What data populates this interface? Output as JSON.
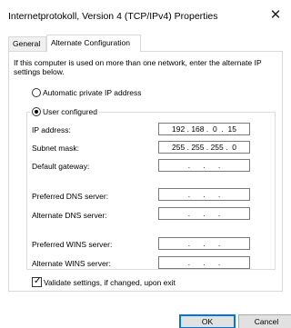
{
  "window": {
    "title": "Internetprotokoll, Version 4 (TCP/IPv4) Properties",
    "close_glyph": "✕"
  },
  "tabs": [
    {
      "label": "General",
      "active": false
    },
    {
      "label": "Alternate Configuration",
      "active": true
    }
  ],
  "description": "If this computer is used on more than one network, enter the alternate IP settings below.",
  "options": {
    "automatic": {
      "label": "Automatic private IP address",
      "selected": false
    },
    "user": {
      "label": "User configured",
      "selected": true
    }
  },
  "fields": {
    "ip_address": {
      "label": "IP address:",
      "value": "192 . 168 .  0  .  15"
    },
    "subnet_mask": {
      "label": "Subnet mask:",
      "value": "255 . 255 . 255 .  0"
    },
    "default_gateway": {
      "label": "Default gateway:",
      "value": ".      .      ."
    },
    "preferred_dns": {
      "label": "Preferred DNS server:",
      "value": ".      .      ."
    },
    "alternate_dns": {
      "label": "Alternate DNS server:",
      "value": ".      .      ."
    },
    "preferred_wins": {
      "label": "Preferred WINS server:",
      "value": ".      .      ."
    },
    "alternate_wins": {
      "label": "Alternate WINS server:",
      "value": ".      .      ."
    }
  },
  "validate": {
    "label": "Validate settings, if changed, upon exit",
    "checked": true
  },
  "buttons": {
    "ok": "OK",
    "cancel": "Cancel"
  }
}
